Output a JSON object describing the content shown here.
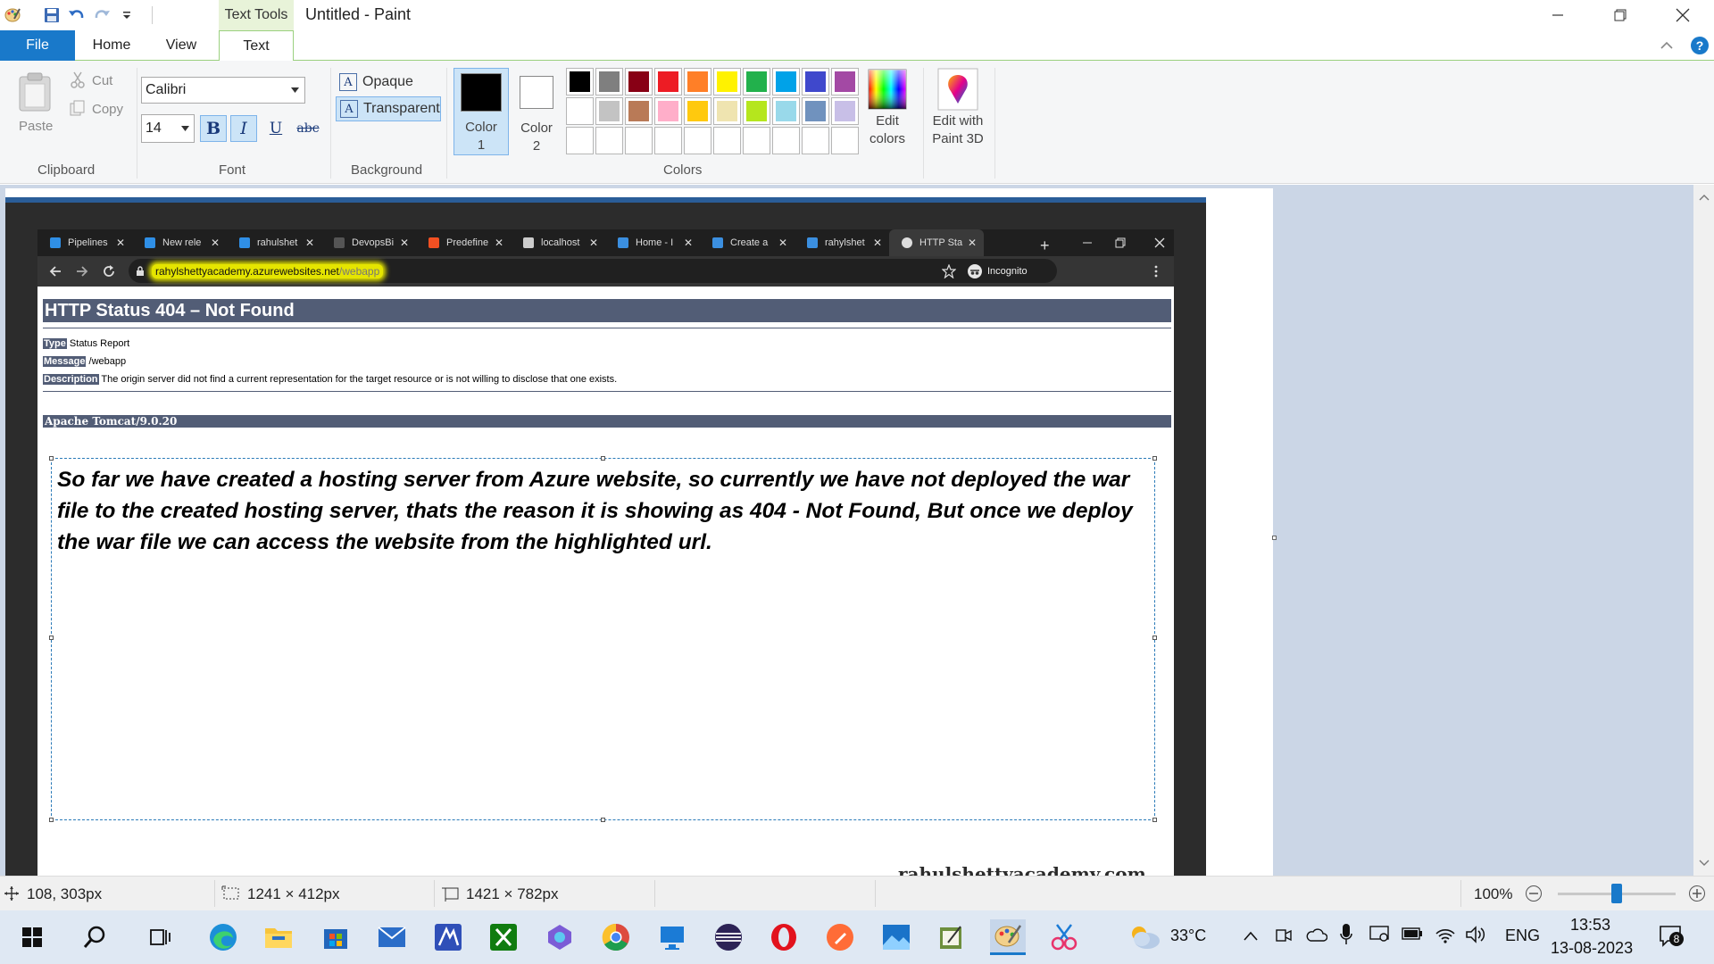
{
  "window": {
    "title": "Untitled - Paint",
    "context_tab": "Text Tools"
  },
  "tabs": {
    "file": "File",
    "home": "Home",
    "view": "View",
    "text": "Text"
  },
  "ribbon": {
    "clipboard": {
      "paste": "Paste",
      "cut": "Cut",
      "copy": "Copy",
      "label": "Clipboard"
    },
    "font": {
      "family": "Calibri",
      "size": "14",
      "label": "Font",
      "bold": "B",
      "italic": "I",
      "underline": "U",
      "strike": "abc"
    },
    "background": {
      "opaque": "Opaque",
      "transparent": "Transparent",
      "label": "Background",
      "icon_glyph": "A"
    },
    "colors": {
      "color1_l1": "Color",
      "color1_l2": "1",
      "color2_l1": "Color",
      "color2_l2": "2",
      "label": "Colors",
      "edit_l1": "Edit",
      "edit_l2": "colors",
      "paint3d_l1": "Edit with",
      "paint3d_l2": "Paint 3D",
      "color1_value": "#000000",
      "color2_value": "#ffffff",
      "palette": [
        "#000000",
        "#7f7f7f",
        "#880015",
        "#ed1c24",
        "#ff7f27",
        "#fff200",
        "#22b14c",
        "#00a2e8",
        "#3f48cc",
        "#a349a4",
        "#ffffff",
        "#c3c3c3",
        "#b97a57",
        "#ffaec9",
        "#ffc90e",
        "#efe4b0",
        "#b5e61d",
        "#99d9ea",
        "#7092be",
        "#c8bfe7",
        "",
        "",
        "",
        "",
        "",
        "",
        "",
        "",
        "",
        ""
      ]
    }
  },
  "browser": {
    "tabs": [
      {
        "label": "Pipelines",
        "icon": "azure-devops-icon",
        "color": "#2f8fe6"
      },
      {
        "label": "New rele",
        "icon": "azure-devops-icon",
        "color": "#2f8fe6"
      },
      {
        "label": "rahulshet",
        "icon": "azure-devops-icon",
        "color": "#2f8fe6"
      },
      {
        "label": "DevopsBi",
        "icon": "blank-page-icon",
        "color": "#555555"
      },
      {
        "label": "Predefine",
        "icon": "microsoft-icon",
        "color": "#f25022"
      },
      {
        "label": "localhost",
        "icon": "page-icon",
        "color": "#cccccc"
      },
      {
        "label": "Home - I",
        "icon": "azure-icon",
        "color": "#3b8fe0"
      },
      {
        "label": "Create a",
        "icon": "azure-icon",
        "color": "#3b8fe0"
      },
      {
        "label": "rahylshet",
        "icon": "azure-icon",
        "color": "#3b8fe0"
      },
      {
        "label": "HTTP Sta",
        "icon": "globe-icon",
        "color": "#dddddd"
      }
    ],
    "url_host": "rahylshettyacademy.azurewebsites.net",
    "url_path": "/webapp",
    "incognito": "Incognito",
    "new_tab": "+"
  },
  "page": {
    "heading": "HTTP Status 404 – Not Found",
    "type_label": "Type",
    "type_value": "Status Report",
    "message_label": "Message",
    "message_value": "/webapp",
    "description_label": "Description",
    "description_value": "The origin server did not find a current representation for the target resource or is not willing to disclose that one exists.",
    "server": "Apache Tomcat/9.0.20",
    "watermark": "rahulshettyacademy.com"
  },
  "textbox": {
    "content": "So far we have created a hosting server from Azure website, so currently we have not deployed the war file to the created hosting server, thats the reason it is showing as 404 - Not Found, But once we deploy the war file we can access the website from the highlighted url."
  },
  "statusbar": {
    "cursor": "108, 303px",
    "selection": "1241 × 412px",
    "image_size": "1421 × 782px",
    "zoom": "100%",
    "zoom_level": 0.5
  },
  "taskbar": {
    "weather": "33°C",
    "language": "ENG",
    "time": "13:53",
    "date": "13-08-2023",
    "notifications": "8"
  }
}
